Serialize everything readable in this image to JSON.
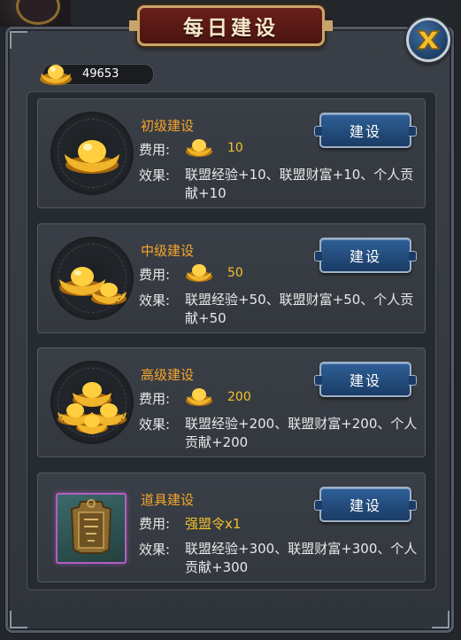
{
  "title": "每日建设",
  "currency": {
    "value": "49653",
    "icon": "gold-ingot-icon"
  },
  "colors": {
    "accent": "#f7a52b",
    "gold": "#f2c12a",
    "title_plate": "#5a1a14",
    "button": "#244d7e"
  },
  "items": [
    {
      "name": "初级建设",
      "cost_label": "费用:",
      "cost_value": "10",
      "effect_label": "效果:",
      "effect_text": "联盟经验+10、联盟财富+10、个人贡献+10",
      "button": "建设",
      "icon": "single-gold-ingot-icon"
    },
    {
      "name": "中级建设",
      "cost_label": "费用:",
      "cost_value": "50",
      "effect_label": "效果:",
      "effect_text": "联盟经验+50、联盟财富+50、个人贡献+50",
      "button": "建设",
      "icon": "double-gold-ingot-icon"
    },
    {
      "name": "高级建设",
      "cost_label": "费用:",
      "cost_value": "200",
      "effect_label": "效果:",
      "effect_text": "联盟经验+200、联盟财富+200、个人贡献+200",
      "button": "建设",
      "icon": "gold-ingot-pile-icon"
    },
    {
      "name": "道具建设",
      "cost_label": "费用:",
      "cost_value": "强盟令x1",
      "effect_label": "效果:",
      "effect_text": "联盟经验+300、联盟财富+300、个人贡献+300",
      "button": "建设",
      "icon": "alliance-token-icon"
    }
  ]
}
